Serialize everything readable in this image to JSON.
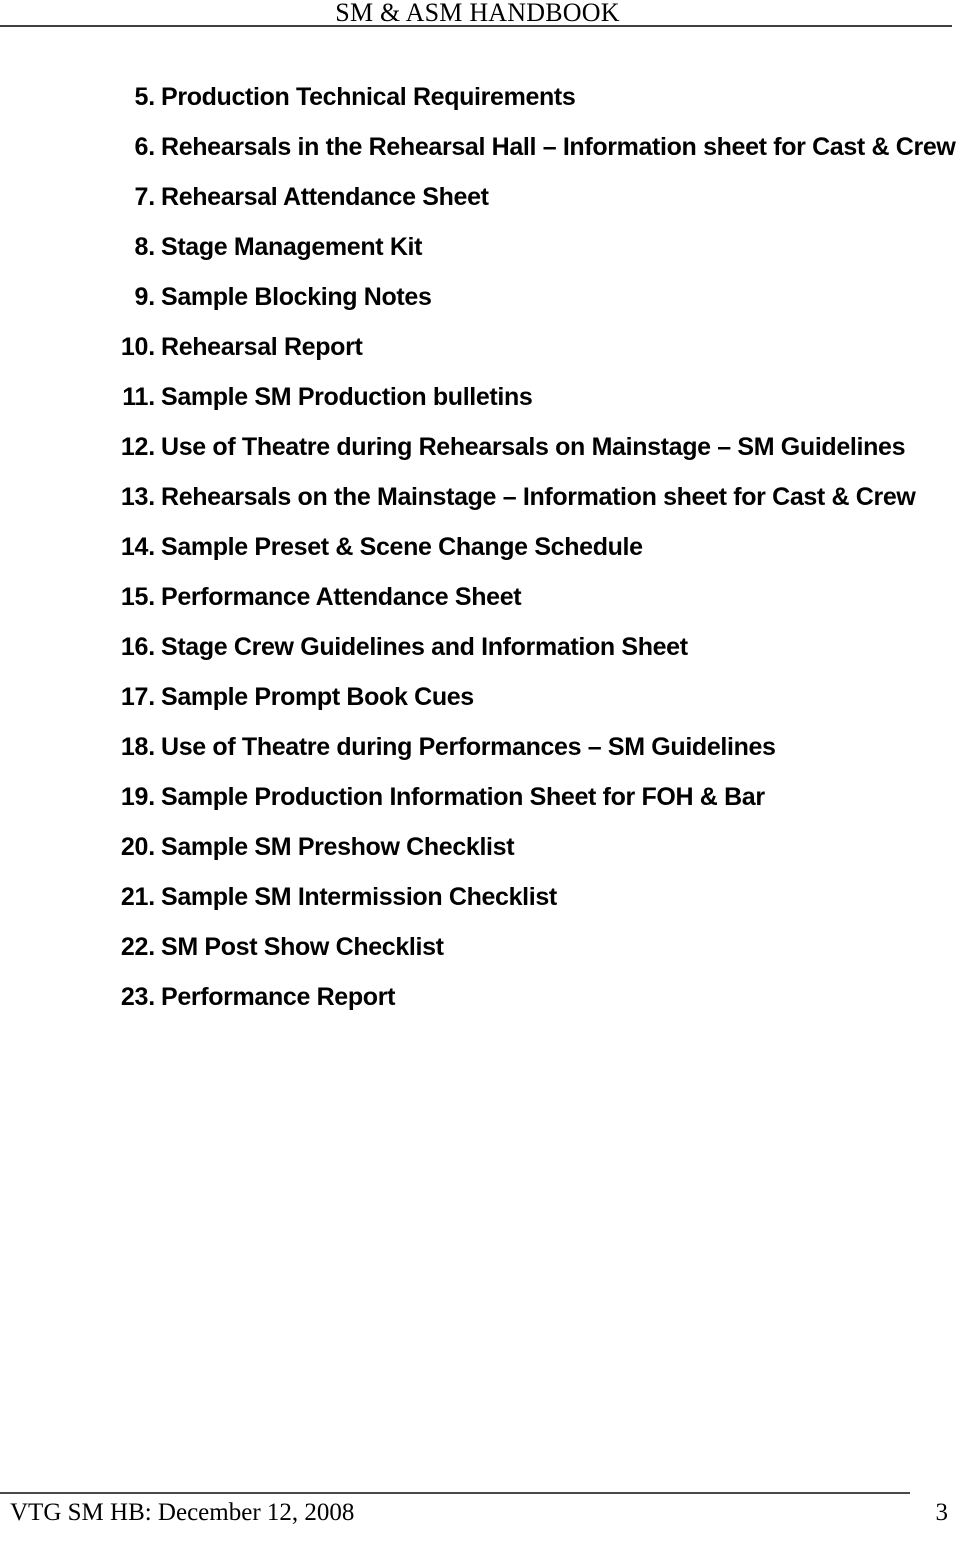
{
  "document": {
    "header": {
      "title": "SM & ASM HANDBOOK"
    },
    "footer": {
      "left_text": "VTG SM HB: December 12, 2008",
      "page_number": "3"
    },
    "toc": {
      "items": [
        {
          "number": "5.",
          "label": "Production Technical Requirements"
        },
        {
          "number": "6.",
          "label": "Rehearsals in the Rehearsal Hall – Information sheet for Cast & Crew"
        },
        {
          "number": "7.",
          "label": "Rehearsal Attendance Sheet"
        },
        {
          "number": "8.",
          "label": "Stage Management Kit"
        },
        {
          "number": "9.",
          "label": "Sample Blocking Notes"
        },
        {
          "number": "10.",
          "label": "Rehearsal Report"
        },
        {
          "number": "11.",
          "label": "Sample SM Production bulletins"
        },
        {
          "number": "12.",
          "label": "Use of Theatre during Rehearsals on Mainstage – SM Guidelines"
        },
        {
          "number": "13.",
          "label": "Rehearsals on the Mainstage – Information sheet for Cast & Crew"
        },
        {
          "number": "14.",
          "label": "Sample Preset & Scene Change Schedule"
        },
        {
          "number": "15.",
          "label": "Performance Attendance Sheet"
        },
        {
          "number": "16.",
          "label": "Stage Crew Guidelines and Information Sheet"
        },
        {
          "number": "17.",
          "label": "Sample Prompt Book Cues"
        },
        {
          "number": "18.",
          "label": "Use of Theatre during Performances – SM Guidelines"
        },
        {
          "number": "19.",
          "label": "Sample Production Information Sheet for FOH & Bar"
        },
        {
          "number": "20.",
          "label": "Sample SM Preshow Checklist"
        },
        {
          "number": "21.",
          "label": "Sample SM Intermission Checklist"
        },
        {
          "number": "22.",
          "label": "SM Post Show Checklist"
        },
        {
          "number": "23.",
          "label": "Performance Report"
        }
      ]
    }
  }
}
